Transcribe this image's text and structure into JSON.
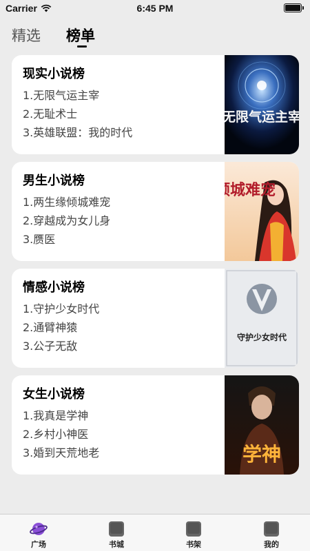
{
  "status_bar": {
    "carrier": "Carrier",
    "time": "6:45 PM"
  },
  "top_tabs": [
    {
      "label": "精选",
      "active": false
    },
    {
      "label": "榜单",
      "active": true
    }
  ],
  "rankings": [
    {
      "title": "现实小说榜",
      "items": [
        "1.无限气运主宰",
        "2.无耻术士",
        "3.英雄联盟：我的时代"
      ],
      "cover_text": "无限气运主宰"
    },
    {
      "title": "男生小说榜",
      "items": [
        "1.两生缘倾城难宠",
        "2.穿越成为女儿身",
        "3.赝医"
      ],
      "cover_text": "倾城难宠"
    },
    {
      "title": "情感小说榜",
      "items": [
        "1.守护少女时代",
        "2.通臂神猿",
        "3.公子无敌"
      ],
      "cover_text": "守护少女时代"
    },
    {
      "title": "女生小说榜",
      "items": [
        "1.我真是学神",
        "2.乡村小神医",
        "3.婚到天荒地老"
      ],
      "cover_text": "学神"
    }
  ],
  "tab_bar": [
    {
      "label": "广场",
      "icon": "planet-icon"
    },
    {
      "label": "书城",
      "icon": "book-placeholder-icon"
    },
    {
      "label": "书架",
      "icon": "book-placeholder-icon"
    },
    {
      "label": "我的",
      "icon": "book-placeholder-icon"
    }
  ]
}
